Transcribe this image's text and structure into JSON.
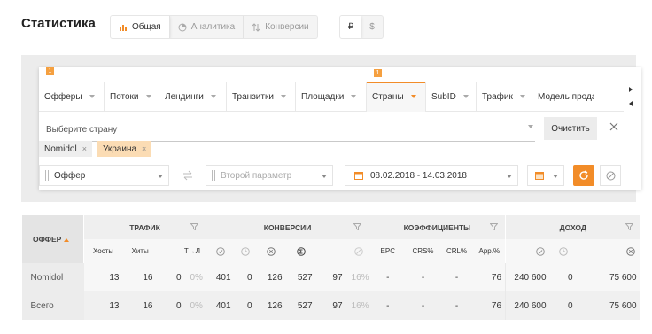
{
  "page": {
    "title": "Статистика"
  },
  "view_tabs": [
    {
      "label": "Общая",
      "icon": "bar-chart-icon",
      "active": true
    },
    {
      "label": "Аналитика",
      "icon": "pie-chart-icon",
      "active": false
    },
    {
      "label": "Конверсии",
      "icon": "sort-arrows-icon",
      "active": false
    }
  ],
  "currency_tabs": [
    {
      "label": "₽",
      "active": true
    },
    {
      "label": "$",
      "active": false
    }
  ],
  "filters": {
    "dimension_tabs": [
      {
        "label": "Офферы",
        "badge": "1",
        "active": false
      },
      {
        "label": "Потоки",
        "active": false
      },
      {
        "label": "Лендинги",
        "active": false
      },
      {
        "label": "Транзитки",
        "active": false
      },
      {
        "label": "Площадки",
        "active": false
      },
      {
        "label": "Страны",
        "badge": "1",
        "active": true
      },
      {
        "label": "SubID",
        "active": false
      },
      {
        "label": "Трафик",
        "active": false
      },
      {
        "label": "Модель прода",
        "active": false
      }
    ],
    "country_placeholder": "Выберите страну",
    "clear_label": "Очистить",
    "chips": [
      {
        "label": "Nomidol",
        "remove": "×"
      },
      {
        "label": "Украина",
        "remove": "×"
      }
    ],
    "first_param": "Оффер",
    "second_param": "Второй параметр",
    "date_range": "08.02.2018 - 14.03.2018",
    "accent_color": "#f28c28"
  },
  "table": {
    "offer_header": "ОФФЕР",
    "groups": {
      "traffic": "ТРАФИК",
      "conversions": "КОНВЕРСИИ",
      "coefficients": "КОЭФФИЦИЕНТЫ",
      "income": "ДОХОД"
    },
    "sub": {
      "hosts": "Хосты",
      "hits": "Хиты",
      "t_to_l": "Т→Л",
      "epc": "EPC",
      "crs": "CRS%",
      "crl": "CRL%",
      "app": "App.%"
    },
    "rows": [
      {
        "name": "Nomidol",
        "hosts": "13",
        "hits": "16",
        "tl": "0",
        "tl_pct": "0%",
        "conv_approved": "401",
        "conv_hold": "0",
        "conv_rejected": "126",
        "conv_total": "527",
        "conv_extra": "97",
        "conv_extra_pct": "16%",
        "epc": "-",
        "crs": "-",
        "crl": "-",
        "app": "76",
        "inc_approved": "240 600",
        "inc_hold": "0",
        "inc_rejected": "75 600"
      },
      {
        "name": "Всего",
        "hosts": "13",
        "hits": "16",
        "tl": "0",
        "tl_pct": "0%",
        "conv_approved": "401",
        "conv_hold": "0",
        "conv_rejected": "126",
        "conv_total": "527",
        "conv_extra": "97",
        "conv_extra_pct": "16%",
        "epc": "-",
        "crs": "-",
        "crl": "-",
        "app": "76",
        "inc_approved": "240 600",
        "inc_hold": "0",
        "inc_rejected": "75 600"
      }
    ]
  }
}
